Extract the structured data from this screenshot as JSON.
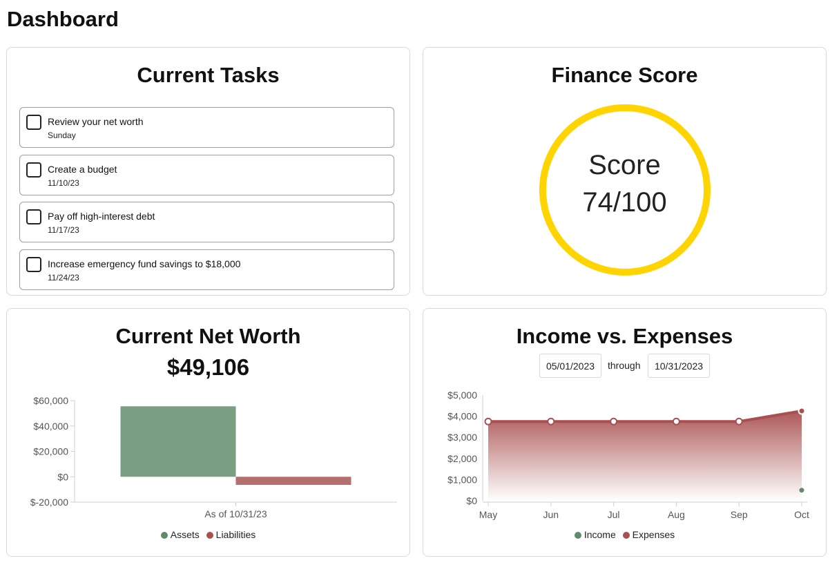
{
  "page": {
    "title": "Dashboard"
  },
  "tasks": {
    "title": "Current Tasks",
    "items": [
      {
        "label": "Review your net worth",
        "date": "Sunday"
      },
      {
        "label": "Create a budget",
        "date": "11/10/23"
      },
      {
        "label": "Pay off high-interest debt",
        "date": "11/17/23"
      },
      {
        "label": "Increase emergency fund savings to $18,000",
        "date": "11/24/23"
      }
    ]
  },
  "finance_score": {
    "title": "Finance Score",
    "label": "Score",
    "value": "74/100",
    "score": 74,
    "max": 100,
    "ring_color": "#ffd400"
  },
  "net_worth": {
    "title": "Current Net Worth",
    "value": "$49,106",
    "legend": [
      {
        "name": "Assets",
        "color": "#5e8c6a"
      },
      {
        "name": "Liabilities",
        "color": "#a94f4f"
      }
    ]
  },
  "income_expenses": {
    "title": "Income vs. Expenses",
    "start_date": "05/01/2023",
    "through_label": "through",
    "end_date": "10/31/2023",
    "legend": [
      {
        "name": "Income",
        "color": "#5e8c6a"
      },
      {
        "name": "Expenses",
        "color": "#a94f4f"
      }
    ]
  },
  "chart_data": [
    {
      "type": "bar",
      "title": "Current Net Worth",
      "categories": [
        "As of 10/31/23"
      ],
      "series": [
        {
          "name": "Assets",
          "values": [
            55500
          ],
          "color": "#7a9e84"
        },
        {
          "name": "Liabilities",
          "values": [
            -6400
          ],
          "color": "#b56f6f"
        }
      ],
      "ylim": [
        -20000,
        60000
      ],
      "yticks": [
        60000,
        40000,
        20000,
        0,
        -20000
      ],
      "ytick_labels": [
        "$60,000",
        "$40,000",
        "$20,000",
        "$0",
        "$-20,000"
      ],
      "grid": false,
      "legend_position": "bottom"
    },
    {
      "type": "area",
      "title": "Income vs. Expenses",
      "categories": [
        "May",
        "Jun",
        "Jul",
        "Aug",
        "Sep",
        "Oct"
      ],
      "series": [
        {
          "name": "Income",
          "values": [
            null,
            null,
            null,
            null,
            null,
            500
          ],
          "color": "#5e8c6a"
        },
        {
          "name": "Expenses",
          "values": [
            3750,
            3750,
            3750,
            3750,
            3750,
            4250
          ],
          "color": "#a94f4f"
        }
      ],
      "ylim": [
        0,
        5000
      ],
      "yticks": [
        5000,
        4000,
        3000,
        2000,
        1000,
        0
      ],
      "ytick_labels": [
        "$5,000",
        "$4,000",
        "$3,000",
        "$2,000",
        "$1,000",
        "$0"
      ],
      "grid": false,
      "legend_position": "bottom"
    }
  ]
}
